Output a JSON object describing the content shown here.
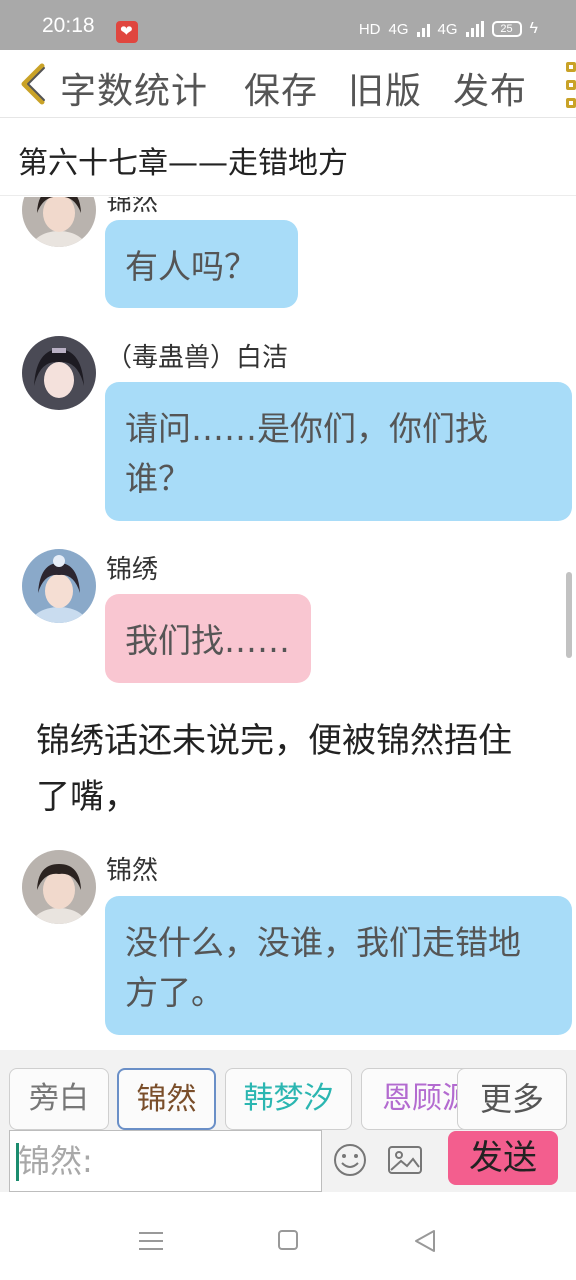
{
  "status_bar": {
    "time": "20:18",
    "network": "HD",
    "signal_1": "4G",
    "signal_2": "4G",
    "battery": "25"
  },
  "toolbar": {
    "word_count_label": "字数统计",
    "save_label": "保存",
    "old_version_label": "旧版",
    "publish_label": "发布"
  },
  "chapter": {
    "title": "第六十七章——走错地方"
  },
  "messages": [
    {
      "speaker": "锦然",
      "text": "有人吗？",
      "color": "blue"
    },
    {
      "speaker": "（毒蛊兽）白洁",
      "text": "请问……是你们，你们找谁？",
      "color": "blue"
    },
    {
      "speaker": "锦绣",
      "text": "我们找……",
      "color": "pink"
    },
    {
      "speaker": "锦然",
      "text": "没什么，没谁，我们走错地方了。",
      "color": "blue"
    }
  ],
  "narration": "锦绣话还未说完，便被锦然捂住了嘴，",
  "character_tabs": [
    "旁白",
    "锦然",
    "韩梦汐",
    "恩顾源"
  ],
  "more_label": "更多",
  "input": {
    "value": "锦然:"
  },
  "send_label": "发送",
  "colors": {
    "bubble_blue": "#a8dcf8",
    "bubble_pink": "#f9c6d1",
    "send_button": "#f35e8e",
    "accent_gold": "#c9a227"
  }
}
